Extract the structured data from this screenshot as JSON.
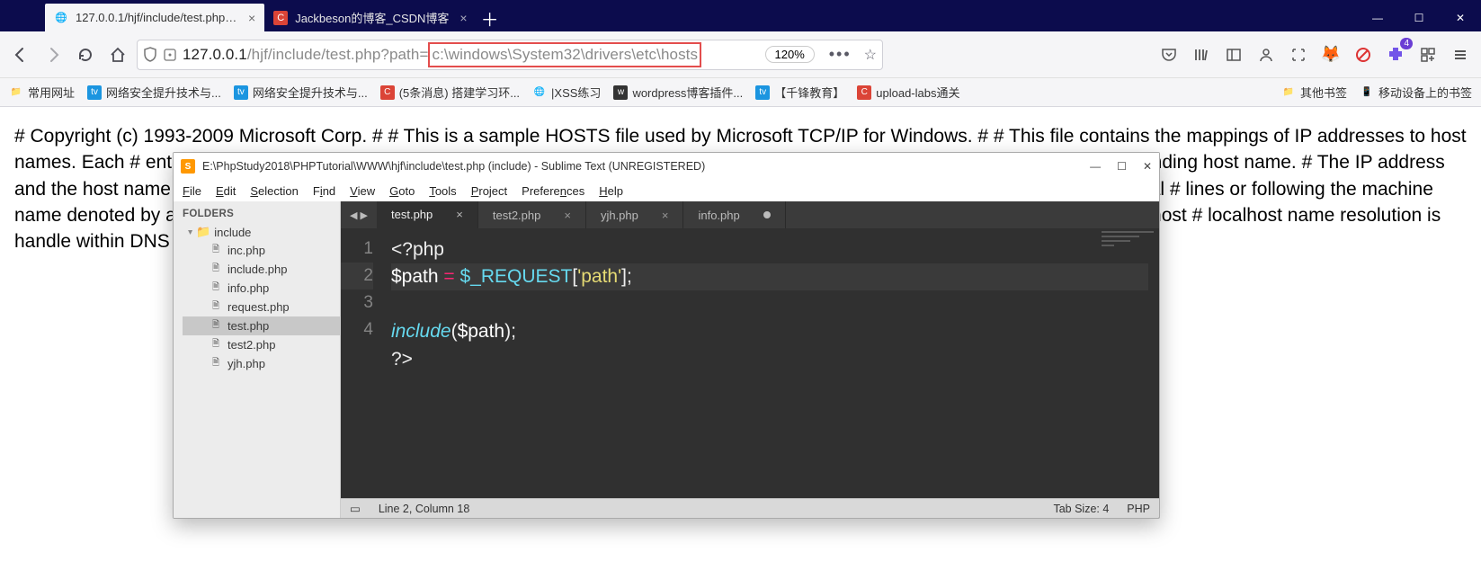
{
  "browser": {
    "tabs": [
      {
        "label": "127.0.0.1/hjf/include/test.php?p",
        "active": true,
        "favicon": "globe"
      },
      {
        "label": "Jackbeson的博客_CSDN博客",
        "active": false,
        "favicon": "C"
      }
    ],
    "url_prefix": "127.0.0.1",
    "url_path": "/hjf/include/test.php?path=",
    "url_highlight": "c:\\windows\\System32\\drivers\\etc\\hosts",
    "zoom": "120%",
    "pocket_badge": "4"
  },
  "bookmarks": {
    "items": [
      {
        "label": "常用网址",
        "fav": "folder"
      },
      {
        "label": "网络安全提升技术与...",
        "fav": "blue"
      },
      {
        "label": "网络安全提升技术与...",
        "fav": "blue"
      },
      {
        "label": "(5条消息) 搭建学习环...",
        "fav": "red"
      },
      {
        "label": "|XSS练习",
        "fav": "globe"
      },
      {
        "label": "wordpress博客插件...",
        "fav": "dark"
      },
      {
        "label": "【千锋教育】",
        "fav": "blue"
      },
      {
        "label": "upload-labs通关",
        "fav": "red"
      }
    ],
    "right": [
      {
        "label": "其他书签",
        "fav": "folder"
      },
      {
        "label": "移动设备上的书签",
        "fav": "mobile"
      }
    ]
  },
  "page_text": "# Copyright (c) 1993-2009 Microsoft Corp. # # This is a sample HOSTS file used by Microsoft TCP/IP for Windows. # # This file contains the mappings of IP addresses to host names. Each # entry should be kept on an individual line. The IP address should # be placed in the first column followed by the corresponding host name. # The IP address and the host name should be separated by at least one # space. # # Additionally, comments (such as these) may be inserted on individual # lines or following the machine name denoted by a '#' symbol. # # For example: # # 102.54.94.97 rhino.acme.com # source server # 38.25.63.10 x.acme.com # x client host # localhost name resolution is handle within DNS itself. # 127.0.0.1 localhost # ::1 localhost",
  "sublime": {
    "title": "E:\\PhpStudy2018\\PHPTutorial\\WWW\\hjf\\include\\test.php (include) - Sublime Text (UNREGISTERED)",
    "menu": [
      "File",
      "Edit",
      "Selection",
      "Find",
      "View",
      "Goto",
      "Tools",
      "Project",
      "Preferences",
      "Help"
    ],
    "sidebar_header": "FOLDERS",
    "folder": "include",
    "files": [
      "inc.php",
      "include.php",
      "info.php",
      "request.php",
      "test.php",
      "test2.php",
      "yjh.php"
    ],
    "selected_file": "test.php",
    "tabs": [
      {
        "label": "test.php",
        "active": true,
        "dirty": false
      },
      {
        "label": "test2.php",
        "active": false,
        "dirty": false
      },
      {
        "label": "yjh.php",
        "active": false,
        "dirty": false
      },
      {
        "label": "info.php",
        "active": false,
        "dirty": true
      }
    ],
    "code_lines": [
      "1",
      "2",
      "3",
      "4"
    ],
    "code": {
      "l1_open": "<?php",
      "l2_var": "$path",
      "l2_eq": " = ",
      "l2_req": "$_REQUEST",
      "l2_br1": "[",
      "l2_str": "'path'",
      "l2_br2": "];",
      "l3_fn": "include",
      "l3_p1": "(",
      "l3_var": "$path",
      "l3_p2": ");",
      "l4_close": "?>"
    },
    "status_left": "Line 2, Column 18",
    "status_tab": "Tab Size: 4",
    "status_lang": "PHP"
  }
}
